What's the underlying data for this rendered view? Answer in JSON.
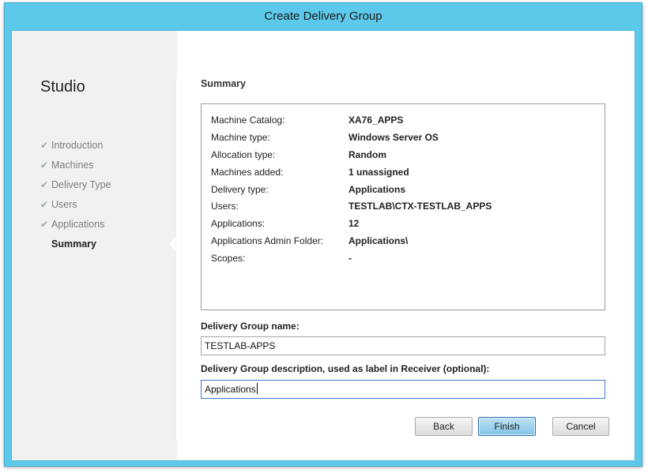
{
  "window": {
    "title": "Create Delivery Group"
  },
  "nav": {
    "title": "Studio",
    "items": [
      {
        "label": "Introduction",
        "done": true,
        "active": false
      },
      {
        "label": "Machines",
        "done": true,
        "active": false
      },
      {
        "label": "Delivery Type",
        "done": true,
        "active": false
      },
      {
        "label": "Users",
        "done": true,
        "active": false
      },
      {
        "label": "Applications",
        "done": true,
        "active": false
      },
      {
        "label": "Summary",
        "done": false,
        "active": true
      }
    ],
    "check_glyph": "✔"
  },
  "page": {
    "heading": "Summary"
  },
  "summary": {
    "rows": [
      {
        "label": "Machine Catalog:",
        "value": "XA76_APPS"
      },
      {
        "label": "Machine type:",
        "value": "Windows Server OS"
      },
      {
        "label": "Allocation type:",
        "value": "Random"
      },
      {
        "label": "Machines added:",
        "value": "1 unassigned"
      },
      {
        "label": "Delivery type:",
        "value": "Applications"
      },
      {
        "label": "Users:",
        "value": "TESTLAB\\CTX-TESTLAB_APPS"
      },
      {
        "label": "Applications:",
        "value": "12"
      },
      {
        "label": "Applications Admin Folder:",
        "value": "Applications\\"
      },
      {
        "label": "Scopes:",
        "value": "-"
      }
    ]
  },
  "form": {
    "name_label": "Delivery Group name:",
    "name_value": "TESTLAB-APPS",
    "description_label": "Delivery Group description, used as label in Receiver (optional):",
    "description_value": "Applications"
  },
  "buttons": {
    "back": "Back",
    "finish": "Finish",
    "cancel": "Cancel"
  },
  "colors": {
    "titlebar": "#5dc9ea",
    "primary_button": "#83c3e8",
    "nav_muted": "#7d7d7d"
  }
}
